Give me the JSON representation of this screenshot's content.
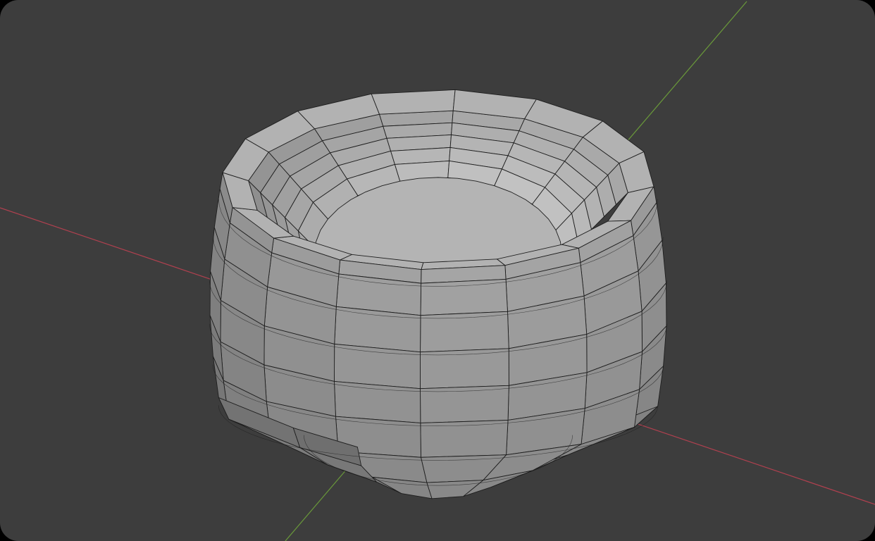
{
  "viewport": {
    "background_color": "#3d3d3d",
    "x_axis_color": "#b0404f",
    "y_axis_color": "#6a9a3a",
    "mesh_face_color": "#a9a9a9",
    "mesh_edge_color": "#1e1e1e",
    "object": "bowl-mesh",
    "shading": "solid",
    "overlay": "wireframe"
  }
}
